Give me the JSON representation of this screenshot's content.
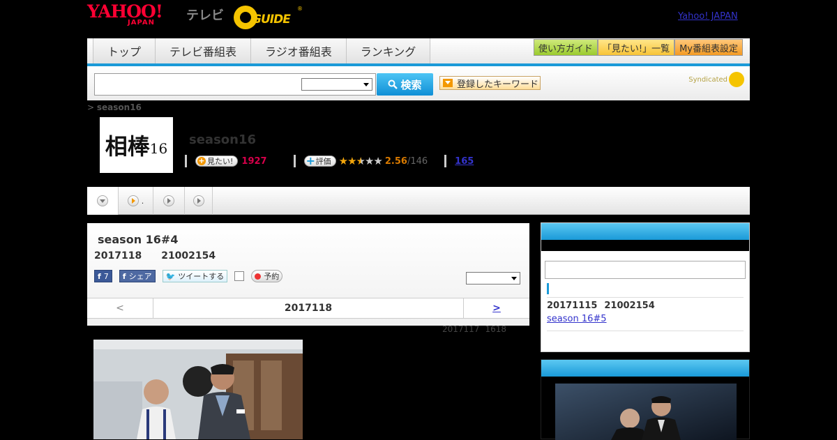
{
  "header": {
    "logo_main": "YAHOO!",
    "logo_sub": "JAPAN",
    "tv_label": "テレビ",
    "gguide_label": "GUIDE",
    "gguide_reg": "®",
    "yahoo_japan_link": "Yahoo! JAPAN"
  },
  "nav": {
    "tabs": [
      "トップ",
      "テレビ番組表",
      "ラジオ番組表",
      "ランキング"
    ],
    "buttons": [
      "使い方ガイド",
      "「見たい!」一覧",
      "My番組表設定"
    ]
  },
  "search": {
    "input_value": "",
    "select_value": "",
    "button_label": "検索",
    "keyword_button": "登録したキーワード",
    "syndicated": "Syndicated"
  },
  "breadcrumb": {
    "sep": ">",
    "current": "season16"
  },
  "program": {
    "poster_text": "相棒",
    "poster_num": "16",
    "title": "season16",
    "want_label": "見たい!",
    "want_count": "1927",
    "rate_label": "評価",
    "rating_stars": 2.56,
    "rating_value": "2.56",
    "rating_count": "/146",
    "reviews_link": "165",
    "subtab2_text": "."
  },
  "episode": {
    "title": "season 16#4",
    "date": "2017118",
    "time": "21002154",
    "fb_like_count": "7",
    "fb_share": "シェア",
    "tweet": "ツイートする",
    "reserve": "予約",
    "select_value": "",
    "pager_prev": "<",
    "pager_current": "2017118",
    "pager_next": ">",
    "updated_date": "2017117",
    "updated_time": "1618"
  },
  "sidebar": {
    "search_value": "",
    "next_date": "20171115",
    "next_time": "21002154",
    "next_link": " season 16#5 "
  },
  "colors": {
    "accent_blue": "#1b9ad8",
    "want_pink": "#d6004a",
    "rating_orange": "#d97a00",
    "link_blue": "#3333cc"
  }
}
